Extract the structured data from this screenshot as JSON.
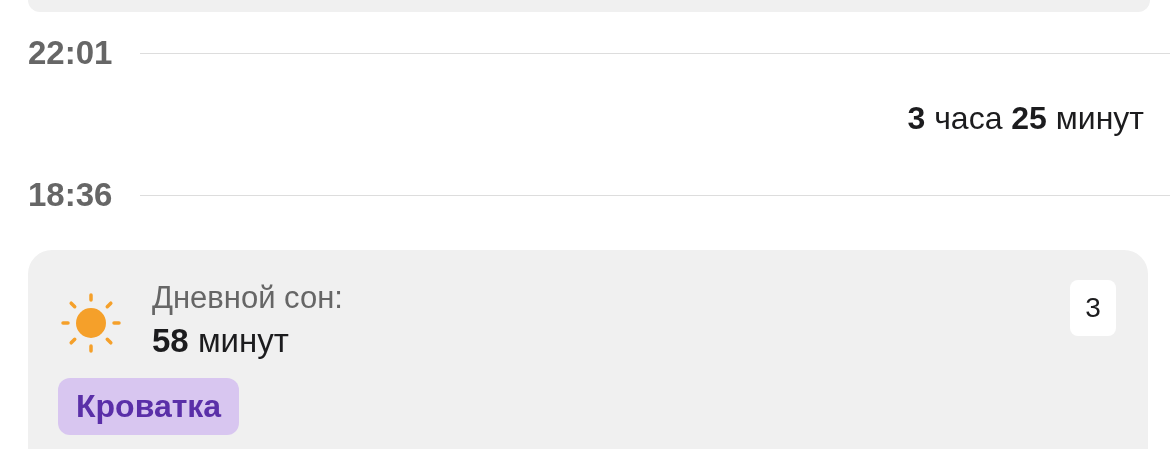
{
  "timeline": [
    {
      "kind": "time",
      "text": "22:01"
    },
    {
      "kind": "duration",
      "text": "**3** часа **25** минут"
    },
    {
      "kind": "time",
      "text": "18:36"
    }
  ],
  "entry": {
    "label": "Дневной сон:",
    "value": "**58** минут",
    "badge": "3",
    "tags": [
      "Кроватка"
    ]
  }
}
